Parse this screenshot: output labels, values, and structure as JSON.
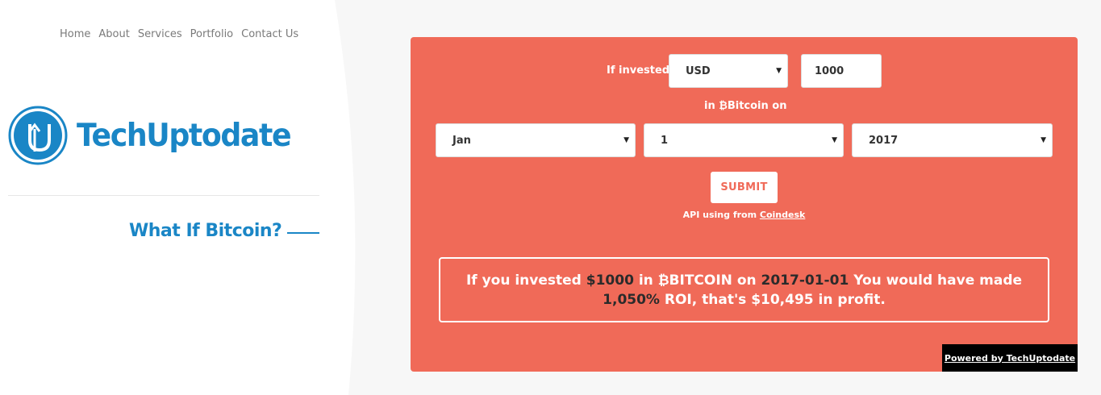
{
  "nav": {
    "items": [
      {
        "label": "Home"
      },
      {
        "label": "About"
      },
      {
        "label": "Services"
      },
      {
        "label": "Portfolio"
      },
      {
        "label": "Contact Us"
      }
    ]
  },
  "brand": {
    "logo_text": "TechUptodate",
    "logo_color": "#1a86c6"
  },
  "site_title": "What If Bitcoin?",
  "form": {
    "if_invested_label": "If invested",
    "currency": {
      "value": "USD"
    },
    "amount": {
      "value": "1000"
    },
    "in_bitcoin_label": "in ₿Bitcoin on",
    "month": {
      "value": "Jan"
    },
    "day": {
      "value": "1"
    },
    "year": {
      "value": "2017"
    },
    "submit_label": "SUBMIT",
    "api_prefix": "API using from",
    "api_link": "Coindesk"
  },
  "result": {
    "p1": "If you invested ",
    "amount": "$1000",
    "p2": " in ₿BITCOIN on ",
    "date": "2017-01-01",
    "p3": " You would have made ",
    "roi": "1,050%",
    "p4": " ROI, that's $10,495 in profit."
  },
  "footer": {
    "powered_by": "Powered by TechUptodate"
  },
  "colors": {
    "panel": "#f06a58",
    "accent": "#1a86c6"
  }
}
